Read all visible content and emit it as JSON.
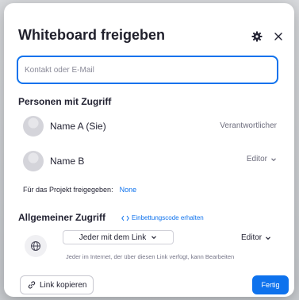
{
  "dialog": {
    "title": "Whiteboard freigeben",
    "search": {
      "placeholder": "Kontakt oder E-Mail",
      "value": ""
    },
    "people_section": {
      "heading": "Personen mit Zugriff",
      "people": [
        {
          "name": "Name A (Sie)",
          "role": "Verantwortlicher"
        },
        {
          "name": "Name B",
          "role": "Editor"
        }
      ]
    },
    "project": {
      "label": "Für das Projekt freigegeben:",
      "value": "None"
    },
    "general_access": {
      "heading": "Allgemeiner Zugriff",
      "embed_link": "Einbettungscode erhalten",
      "scope": "Jeder mit dem Link",
      "role": "Editor",
      "description": "Jeder im Internet, der über diesen Link verfügt, kann Bearbeiten"
    },
    "footer": {
      "copy_link": "Link kopieren",
      "done": "Fertig"
    }
  },
  "colors": {
    "accent": "#0e72ed",
    "text": "#232333",
    "muted": "#6e6e7e"
  },
  "icons": [
    "gear-icon",
    "close-icon",
    "chevron-down-icon",
    "code-icon",
    "globe-icon",
    "link-icon"
  ]
}
